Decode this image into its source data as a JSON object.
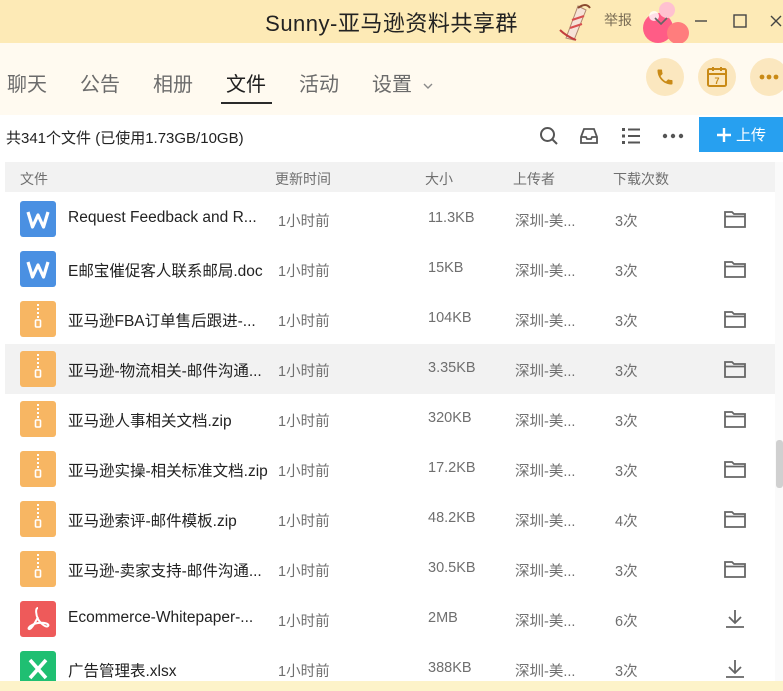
{
  "window": {
    "title": "Sunny-亚马逊资料共享群",
    "report_label": "举报"
  },
  "tabs": [
    {
      "label": "聊天"
    },
    {
      "label": "公告"
    },
    {
      "label": "相册"
    },
    {
      "label": "文件"
    },
    {
      "label": "活动"
    },
    {
      "label": "设置"
    }
  ],
  "active_tab": "文件",
  "toolbar": {
    "file_count": "共341个文件 (已使用1.73GB/10GB)",
    "upload_label": "上传"
  },
  "calendar_day": "7",
  "table": {
    "headers": [
      "文件",
      "更新时间",
      "大小",
      "上传者",
      "下载次数"
    ],
    "rows": [
      {
        "type": "word",
        "name": "Request Feedback and R...",
        "time": "1小时前",
        "size": "11.3KB",
        "uploader": "深圳-美...",
        "downloads": "3次",
        "action": "folder"
      },
      {
        "type": "word",
        "name": "E邮宝催促客人联系邮局.doc",
        "time": "1小时前",
        "size": "15KB",
        "uploader": "深圳-美...",
        "downloads": "3次",
        "action": "folder"
      },
      {
        "type": "zip",
        "name": "亚马逊FBA订单售后跟进-...",
        "time": "1小时前",
        "size": "104KB",
        "uploader": "深圳-美...",
        "downloads": "3次",
        "action": "folder"
      },
      {
        "type": "zip",
        "name": "亚马逊-物流相关-邮件沟通...",
        "time": "1小时前",
        "size": "3.35KB",
        "uploader": "深圳-美...",
        "downloads": "3次",
        "action": "folder",
        "highlighted": true
      },
      {
        "type": "zip",
        "name": "亚马逊人事相关文档.zip",
        "time": "1小时前",
        "size": "320KB",
        "uploader": "深圳-美...",
        "downloads": "3次",
        "action": "folder"
      },
      {
        "type": "zip",
        "name": "亚马逊实操-相关标准文档.zip",
        "time": "1小时前",
        "size": "17.2KB",
        "uploader": "深圳-美...",
        "downloads": "3次",
        "action": "folder"
      },
      {
        "type": "zip",
        "name": "亚马逊索评-邮件模板.zip",
        "time": "1小时前",
        "size": "48.2KB",
        "uploader": "深圳-美...",
        "downloads": "4次",
        "action": "folder"
      },
      {
        "type": "zip",
        "name": "亚马逊-卖家支持-邮件沟通...",
        "time": "1小时前",
        "size": "30.5KB",
        "uploader": "深圳-美...",
        "downloads": "3次",
        "action": "folder"
      },
      {
        "type": "pdf",
        "name": "Ecommerce-Whitepaper-...",
        "time": "1小时前",
        "size": "2MB",
        "uploader": "深圳-美...",
        "downloads": "6次",
        "action": "download"
      },
      {
        "type": "excel",
        "name": "广告管理表.xlsx",
        "time": "1小时前",
        "size": "388KB",
        "uploader": "深圳-美...",
        "downloads": "3次",
        "action": "download"
      }
    ]
  },
  "colors": {
    "titlebar_bg": "#fdeab6",
    "word": "#4a90e2",
    "zip": "#f7b663",
    "pdf": "#ee5a5a",
    "excel": "#1fbf72",
    "upload": "#27a0f0"
  }
}
